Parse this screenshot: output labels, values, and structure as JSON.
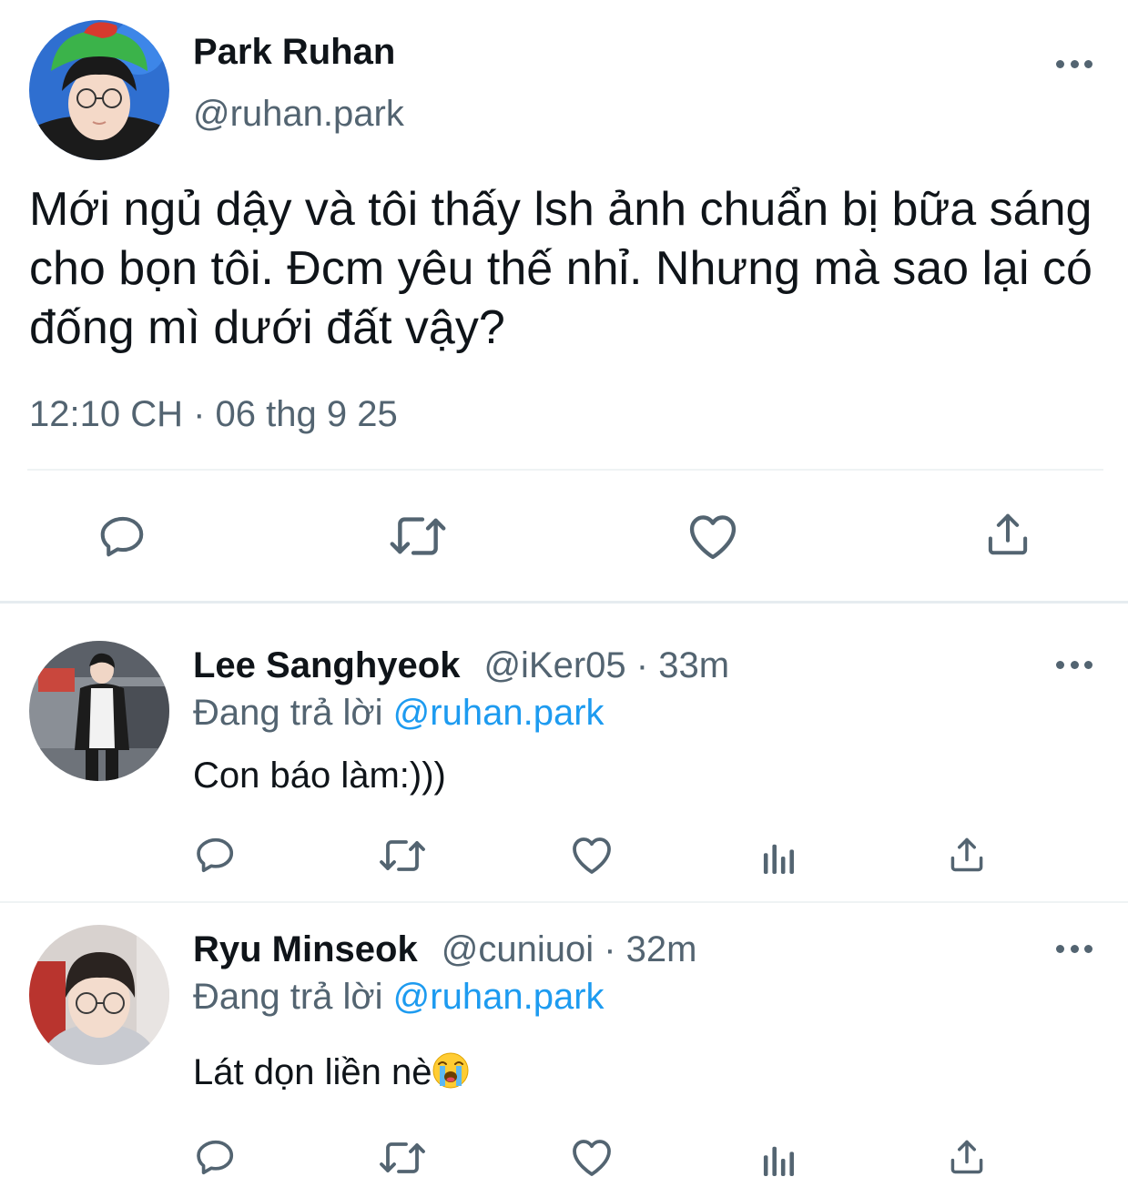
{
  "main_tweet": {
    "author_name": "Park Ruhan",
    "author_handle": "@ruhan.park",
    "text": "Mới ngủ dậy và tôi thấy lsh ảnh chuẩn bị bữa sáng cho bọn tôi. Đcm yêu thế nhỉ. Nhưng mà sao lại có đống mì dưới đất vậy?",
    "timestamp": "12:10 CH · 06 thg 9 25",
    "actions": [
      "reply-icon",
      "retweet-icon",
      "like-icon",
      "share-icon"
    ]
  },
  "replies": [
    {
      "author_name": "Lee Sanghyeok",
      "author_handle": "@iKer05",
      "separator": "·",
      "time": "33m",
      "replying_prefix": "Đang trả lời",
      "replying_to": "@ruhan.park",
      "text": "Con báo làm:)))",
      "actions": [
        "reply-icon",
        "retweet-icon",
        "like-icon",
        "analytics-icon",
        "share-icon"
      ]
    },
    {
      "author_name": "Ryu Minseok",
      "author_handle": "@cuniuoi",
      "separator": "·",
      "time": "32m",
      "replying_prefix": "Đang trả lời",
      "replying_to": "@ruhan.park",
      "text": "Lát dọn liền nè",
      "emoji": "loudly-crying-face",
      "actions": [
        "reply-icon",
        "retweet-icon",
        "like-icon",
        "analytics-icon",
        "share-icon"
      ]
    }
  ],
  "colors": {
    "text": "#0f1419",
    "secondary": "#536471",
    "mention": "#1d9bf0",
    "divider": "#eff3f4"
  }
}
